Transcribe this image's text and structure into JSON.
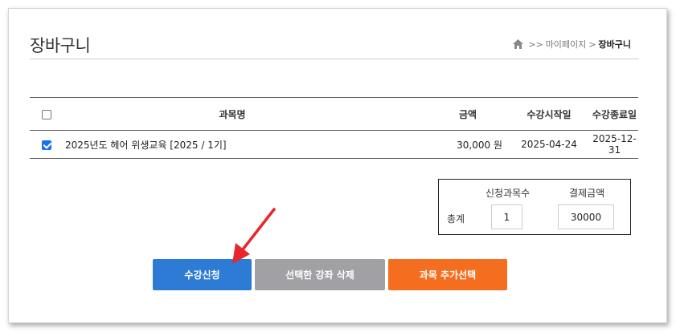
{
  "page": {
    "title": "장바구니"
  },
  "breadcrumb": {
    "separator1": ">>",
    "parent": "마이페이지",
    "separator2": ">",
    "current": "장바구니",
    "home_icon": "home-icon"
  },
  "table": {
    "headers": {
      "name": "과목명",
      "price": "금액",
      "start": "수강시작일",
      "end": "수강종료일"
    },
    "rows": [
      {
        "checked": true,
        "name": "2025년도 헤어 위생교육 [2025 / 1기]",
        "price": "30,000 원",
        "start": "2025-04-24",
        "end": "2025-12-31"
      }
    ],
    "select_all_checked": false
  },
  "summary": {
    "count_label": "신청과목수",
    "amount_label": "결제금액",
    "total_label": "총계",
    "count_value": "1",
    "amount_value": "30000"
  },
  "buttons": {
    "apply": "수강신청",
    "delete": "선택한 강좌 삭제",
    "add": "과목 추가선택"
  },
  "colors": {
    "apply": "#2e7bd6",
    "delete": "#a0a0a5",
    "add": "#f56d1e",
    "annotation_arrow": "#e8262b"
  }
}
